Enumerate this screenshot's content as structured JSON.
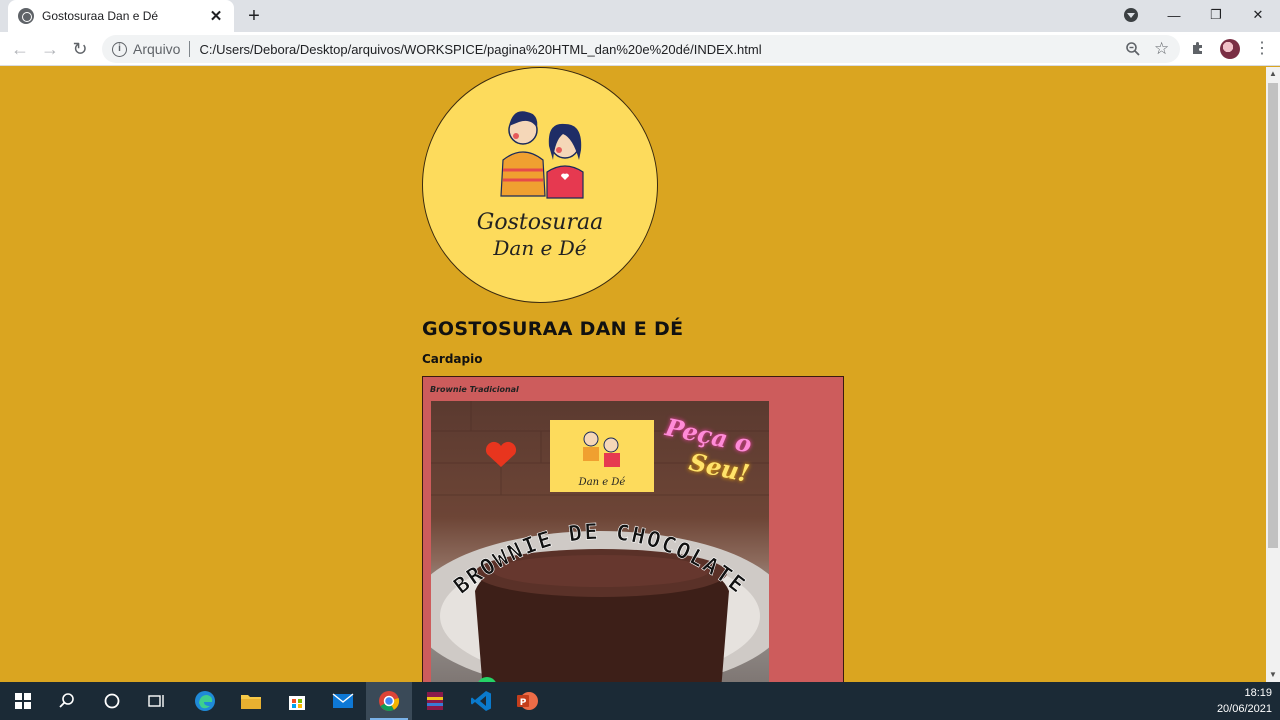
{
  "browser": {
    "tab_title": "Gostosuraa Dan e Dé",
    "tab_close": "✕",
    "new_tab": "+",
    "address_label": "Arquivo",
    "url": "C:/Users/Debora/Desktop/arquivos/WORKSPICE/pagina%20HTML_dan%20e%20dé/INDEX.html",
    "minimize": "—",
    "restore": "❐",
    "close": "✕"
  },
  "page": {
    "logo_text_line1": "Gostosuraa",
    "logo_text_line2": "Dan e Dé",
    "title": "GOSTOSURAA DAN E DÉ",
    "menu_heading": "Cardapio",
    "card": {
      "title": "Brownie Tradicional",
      "photo_text_arc": "BROWNIE DE CHOCOLATE",
      "neon_line1": "Peça o",
      "neon_line2": "Seu!"
    }
  },
  "taskbar": {
    "time": "18:19",
    "date": "20/06/2021"
  },
  "colors": {
    "page_bg": "#daa520",
    "card_bg": "#cd5c5c",
    "logo_bg": "#fddb5c"
  }
}
